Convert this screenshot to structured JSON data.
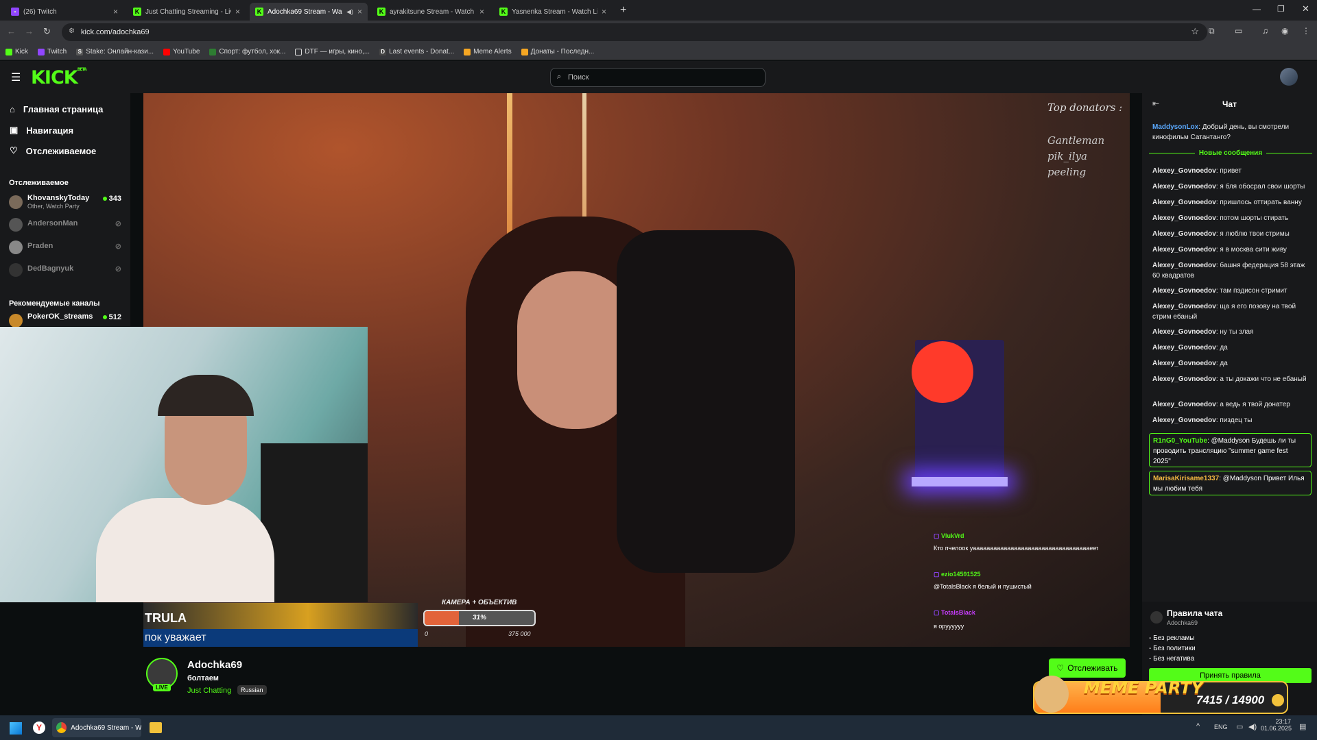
{
  "browser": {
    "tabs": [
      {
        "label": "(26) Twitch",
        "icon": "twitch-icon"
      },
      {
        "label": "Just Chatting Streaming - Live S",
        "icon": "kick-icon"
      },
      {
        "label": "Adochka69 Stream - Watch",
        "icon": "kick-icon",
        "active": true
      },
      {
        "label": "ayrakitsune Stream - Watch Liv",
        "icon": "kick-icon"
      },
      {
        "label": "Yasnenka Stream - Watch Live",
        "icon": "kick-icon"
      }
    ],
    "url": "kick.com/adochka69",
    "bookmarks": [
      {
        "label": "Kick",
        "color": "#53fc18"
      },
      {
        "label": "Twitch",
        "color": "#9146ff"
      },
      {
        "label": "Stake: Онлайн-кази...",
        "color": "#ffffff"
      },
      {
        "label": "YouTube",
        "color": "#ff0000"
      },
      {
        "label": "Спорт: футбол, хок...",
        "color": "#53fc18"
      },
      {
        "label": "DTF — игры, кино,...",
        "color": "#ffffff"
      },
      {
        "label": "Last events - Donat...",
        "color": "#ffffff"
      },
      {
        "label": "Meme Alerts",
        "color": "#f5a623"
      },
      {
        "label": "Донаты - Последн...",
        "color": "#f5a623"
      }
    ]
  },
  "kick": {
    "logo": "KICK",
    "logo_badge": "BETA",
    "search_placeholder": "Поиск"
  },
  "sidebar": {
    "nav": [
      {
        "label": "Главная страница",
        "icon": "home-icon"
      },
      {
        "label": "Навигация",
        "icon": "compass-icon"
      },
      {
        "label": "Отслеживаемое",
        "icon": "heart-icon"
      }
    ],
    "following_title": "Отслеживаемое",
    "following": [
      {
        "name": "KhovanskyToday",
        "sub": "Other, Watch Party",
        "viewers": "343",
        "live": true
      },
      {
        "name": "AndersonMan",
        "live": false
      },
      {
        "name": "Praden",
        "live": false
      },
      {
        "name": "DedBagnyuk",
        "live": false
      }
    ],
    "recommended_title": "Рекомендуемые каналы",
    "recommended": [
      {
        "name": "PokerOK_streams",
        "viewers": "512",
        "live": true
      }
    ]
  },
  "overlay": {
    "top_donators_title": "Top donators :",
    "top_donators": [
      "Gantleman",
      "pik_ilya",
      "peeling"
    ],
    "goal_title": "КАМЕРА + ОБЪЕКТИВ",
    "goal_percent": "31%",
    "goal_fraction": 0.31,
    "goal_min": "0",
    "goal_max": "375 000",
    "ticker_name": "TRULA",
    "ticker_text": "пок уважает",
    "stream_chat": [
      {
        "user": "VlukVrd",
        "text": "Кто пчелоок уааааааааааааааааааааааааааааааааааееттттттттт..."
      },
      {
        "user": "ezio14591525",
        "text": "@TotalsBlack я белый и пушистый"
      },
      {
        "user": "TotalsBlack",
        "text": "я оруууууу"
      }
    ],
    "meme_party_label": "MEME PARTY",
    "meme_party_value": "7415 / 14900",
    "meme_party_fraction": 0.5
  },
  "stream": {
    "streamer": "Adochka69",
    "title": "болтаем",
    "category": "Just Chatting",
    "tag": "Russian",
    "live_badge": "LIVE",
    "follow_label": "Отслеживать"
  },
  "chat": {
    "title": "Чат",
    "pinned": {
      "user": "MaddysonLox",
      "text": "Добрый день, вы смотрели кинофильм Сатантанго?"
    },
    "new_messages_label": "Новые сообщения",
    "messages": [
      {
        "user": "Alexey_Govnoedov",
        "text": "привет"
      },
      {
        "user": "Alexey_Govnoedov",
        "text": "я бля обосрал свои шорты"
      },
      {
        "user": "Alexey_Govnoedov",
        "text": "пришлось оттирать ванну"
      },
      {
        "user": "Alexey_Govnoedov",
        "text": "потом шорты стирать"
      },
      {
        "user": "Alexey_Govnoedov",
        "text": "я люблю твои стримы"
      },
      {
        "user": "Alexey_Govnoedov",
        "text": "я в москва сити живу"
      },
      {
        "user": "Alexey_Govnoedov",
        "text": "башня федерация 58 этаж 60 квадратов"
      },
      {
        "user": "Alexey_Govnoedov",
        "text": "там пэдисон стримит"
      },
      {
        "user": "Alexey_Govnoedov",
        "text": "ща я его позову на твой стрим ебаный"
      },
      {
        "user": "Alexey_Govnoedov",
        "text": "ну ты злая"
      },
      {
        "user": "Alexey_Govnoedov",
        "text": "да"
      },
      {
        "user": "Alexey_Govnoedov",
        "text": "да"
      },
      {
        "user": "Alexey_Govnoedov",
        "text": "а ты докажи что не ебаный"
      },
      {
        "user": "Alexey_Govnoedov",
        "text": "а ведь я твой донатер"
      },
      {
        "user": "Alexey_Govnoedov",
        "text": "пиздец ты"
      }
    ],
    "highlighted": [
      {
        "user": "R1nG0_YouTube",
        "text": "@Maddyson Будешь ли ты проводить трансляцию \"summer game fest 2025\""
      },
      {
        "user": "MarisaKirisame1337",
        "text": "@Maddyson Привет Илья мы любим тебя"
      }
    ],
    "rules_title": "Правила чата",
    "rules_owner": "Adochka69",
    "rules": [
      "- Без рекламы",
      "- Без политики",
      "- Без негатива"
    ],
    "accept_label": "Принять правила"
  },
  "taskbar": {
    "app_label": "Adochka69 Stream - Wa",
    "lang": "ENG",
    "time": "23:17",
    "date": "01.06.2025"
  }
}
